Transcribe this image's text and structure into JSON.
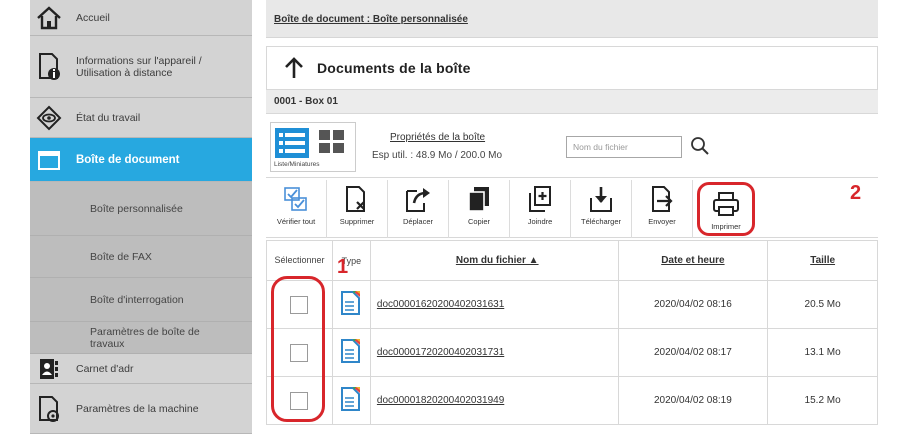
{
  "sidebar": {
    "items": [
      {
        "label": "Accueil",
        "icon": "home-icon"
      },
      {
        "label": "Informations sur l'appareil / Utilisation à distance",
        "icon": "device-info-icon"
      },
      {
        "label": "État du travail",
        "icon": "job-status-icon"
      },
      {
        "label": "Boîte de document",
        "icon": "document-box-icon",
        "active": true
      },
      {
        "label": "Boîte personnalisée"
      },
      {
        "label": "Boîte de FAX"
      },
      {
        "label": "Boîte d'interrogation"
      },
      {
        "label": "Paramètres de boîte de travaux"
      },
      {
        "label": "Carnet d'adr",
        "icon": "address-book-icon"
      },
      {
        "label": "Paramètres de la machine",
        "icon": "machine-settings-icon"
      }
    ]
  },
  "main": {
    "breadcrumb": "Boîte de document : Boîte personnalisée",
    "heading": "Documents de la boîte",
    "box_name": "0001 - Box 01",
    "view_toggle_label": "Liste/Miniatures",
    "properties_link": "Propriétés de la boîte",
    "usage": "Esp util. : 48.9 Mo / 200.0 Mo",
    "search_placeholder": "Nom du fichier"
  },
  "toolbar": [
    {
      "label": "Vérifier tout",
      "icon": "check-all-icon"
    },
    {
      "label": "Supprimer",
      "icon": "delete-icon"
    },
    {
      "label": "Déplacer",
      "icon": "move-icon"
    },
    {
      "label": "Copier",
      "icon": "copy-icon"
    },
    {
      "label": "Joindre",
      "icon": "join-icon"
    },
    {
      "label": "Télécharger",
      "icon": "download-icon"
    },
    {
      "label": "Envoyer",
      "icon": "send-icon"
    },
    {
      "label": "Imprimer",
      "icon": "print-icon"
    }
  ],
  "table": {
    "headers": {
      "select": "Sélectionner",
      "type": "Type",
      "name": "Nom du fichier ▲",
      "date": "Date et heure",
      "size": "Taille"
    },
    "rows": [
      {
        "name": "doc00001620200402031631",
        "date": "2020/04/02 08:16",
        "size": "20.5 Mo"
      },
      {
        "name": "doc00001720200402031731",
        "date": "2020/04/02 08:17",
        "size": "13.1 Mo"
      },
      {
        "name": "doc00001820200402031949",
        "date": "2020/04/02 08:19",
        "size": "15.2 Mo"
      }
    ]
  },
  "callouts": [
    "1",
    "2"
  ],
  "colors": {
    "accent": "#27a8e0",
    "callout": "#d8262b",
    "sidebar": "#c9c9c9"
  }
}
